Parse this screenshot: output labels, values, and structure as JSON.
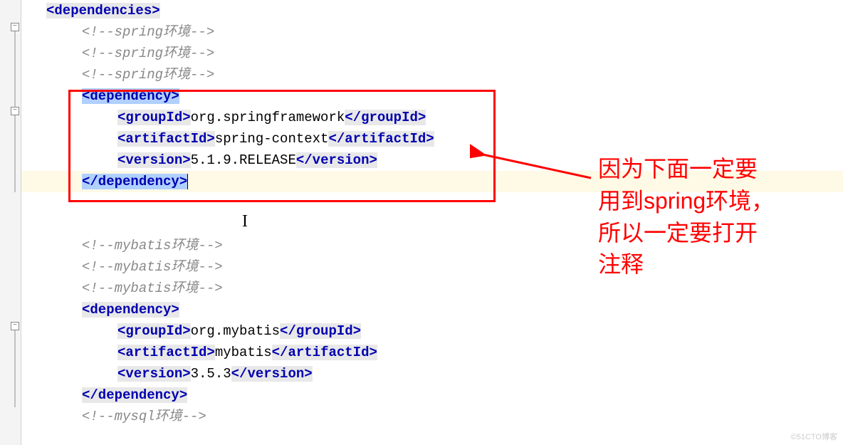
{
  "code": {
    "dependencies_open": "<dependencies>",
    "comment1": "<!--spring环境-->",
    "comment2": "<!--spring环境-->",
    "comment3": "<!--spring环境-->",
    "dep1": {
      "open": "<dependency>",
      "groupId_open": "<groupId>",
      "groupId_val": "org.springframework",
      "groupId_close": "</groupId>",
      "artifactId_open": "<artifactId>",
      "artifactId_val": "spring-context",
      "artifactId_close": "</artifactId>",
      "version_open": "<version>",
      "version_val": "5.1.9.RELEASE",
      "version_close": "</version>",
      "close": "</dependency>"
    },
    "comment4": "<!--mybatis环境-->",
    "comment5": "<!--mybatis环境-->",
    "comment6": "<!--mybatis环境-->",
    "dep2": {
      "open": "<dependency>",
      "groupId_open": "<groupId>",
      "groupId_val": "org.mybatis",
      "groupId_close": "</groupId>",
      "artifactId_open": "<artifactId>",
      "artifactId_val": "mybatis",
      "artifactId_close": "</artifactId>",
      "version_open": "<version>",
      "version_val": "3.5.3",
      "version_close": "</version>",
      "close": "</dependency>"
    },
    "comment7": "<!--mysql环境-->"
  },
  "annotation": {
    "line1": "因为下面一定要",
    "line2": "用到spring环境，",
    "line3": "所以一定要打开",
    "line4": "注释"
  },
  "watermark": "©51CTO博客"
}
